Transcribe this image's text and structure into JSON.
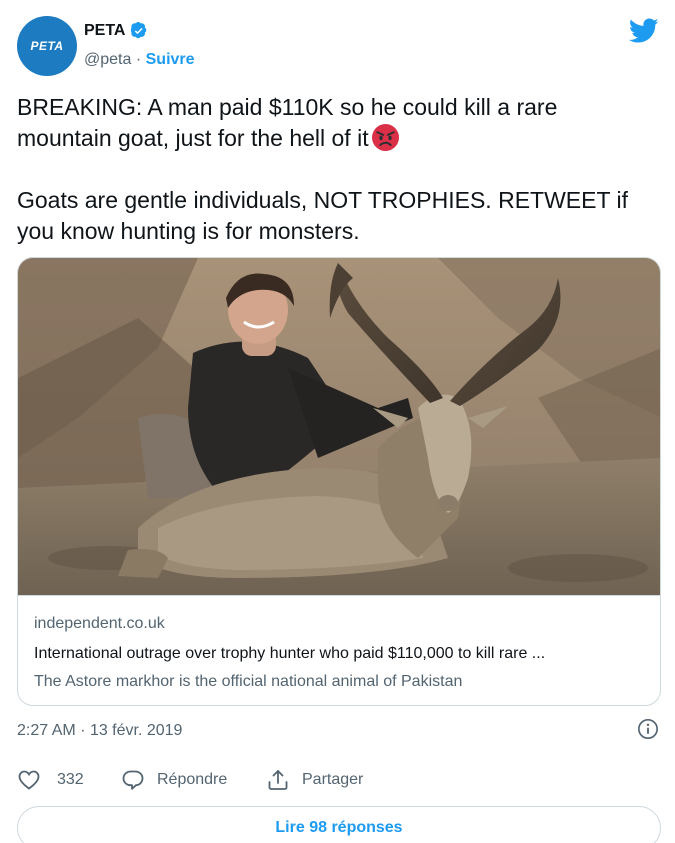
{
  "author": {
    "display_name": "PETA",
    "handle": "@peta",
    "separator": "·",
    "follow_label": "Suivre",
    "avatar_text": "PETA",
    "brand_color": "#1d7bc1",
    "verified": true
  },
  "tweet": {
    "line1": "BREAKING: A man paid $110K so he could kill a rare mountain goat, just for the hell of it",
    "emoji": "angry-face-emoji",
    "line2": "Goats are gentle individuals, NOT TROPHIES. RETWEET if you know hunting is for monsters."
  },
  "card": {
    "domain": "independent.co.uk",
    "title": "International outrage over trophy hunter who paid $110,000 to kill rare ...",
    "description": "The Astore markhor is the official national animal of Pakistan",
    "image_subject": "man posing with dead markhor goat on mountainside"
  },
  "meta": {
    "time": "2:27 AM",
    "date_separator": "·",
    "date": "13 févr. 2019"
  },
  "actions": {
    "like_count": "332",
    "reply_label": "Répondre",
    "share_label": "Partager"
  },
  "replies_button": "Lire 98 réponses",
  "colors": {
    "accent": "#1d9bf0",
    "secondary_text": "#536471",
    "border": "#cfd9de",
    "angry_red": "#e0245e"
  },
  "icons": {
    "bird": "twitter-bird-icon",
    "verified": "verified-badge-icon",
    "info": "info-icon",
    "like": "heart-icon",
    "reply": "reply-bubble-icon",
    "share": "share-icon"
  }
}
